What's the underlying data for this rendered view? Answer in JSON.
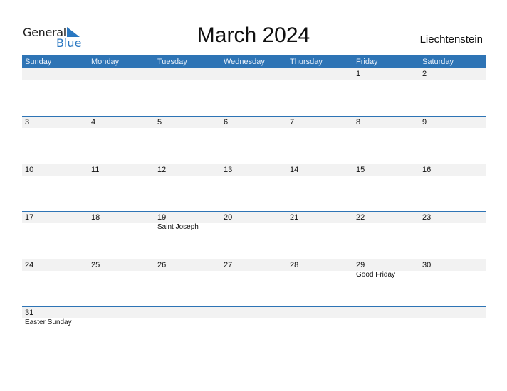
{
  "logo": {
    "general": "General",
    "blue": "Blue"
  },
  "title": "March 2024",
  "country": "Liechtenstein",
  "weekdays": [
    "Sunday",
    "Monday",
    "Tuesday",
    "Wednesday",
    "Thursday",
    "Friday",
    "Saturday"
  ],
  "weeks": [
    [
      {
        "d": ""
      },
      {
        "d": ""
      },
      {
        "d": ""
      },
      {
        "d": ""
      },
      {
        "d": ""
      },
      {
        "d": "1"
      },
      {
        "d": "2"
      }
    ],
    [
      {
        "d": "3"
      },
      {
        "d": "4"
      },
      {
        "d": "5"
      },
      {
        "d": "6"
      },
      {
        "d": "7"
      },
      {
        "d": "8"
      },
      {
        "d": "9"
      }
    ],
    [
      {
        "d": "10"
      },
      {
        "d": "11"
      },
      {
        "d": "12"
      },
      {
        "d": "13"
      },
      {
        "d": "14"
      },
      {
        "d": "15"
      },
      {
        "d": "16"
      }
    ],
    [
      {
        "d": "17"
      },
      {
        "d": "18"
      },
      {
        "d": "19",
        "h": "Saint Joseph"
      },
      {
        "d": "20"
      },
      {
        "d": "21"
      },
      {
        "d": "22"
      },
      {
        "d": "23"
      }
    ],
    [
      {
        "d": "24"
      },
      {
        "d": "25"
      },
      {
        "d": "26"
      },
      {
        "d": "27"
      },
      {
        "d": "28"
      },
      {
        "d": "29",
        "h": "Good Friday"
      },
      {
        "d": "30"
      }
    ],
    [
      {
        "d": "31",
        "h": "Easter Sunday"
      },
      {
        "d": ""
      },
      {
        "d": ""
      },
      {
        "d": ""
      },
      {
        "d": ""
      },
      {
        "d": ""
      },
      {
        "d": ""
      }
    ]
  ],
  "colors": {
    "accent": "#2e74b5",
    "strip": "#f2f2f2"
  }
}
